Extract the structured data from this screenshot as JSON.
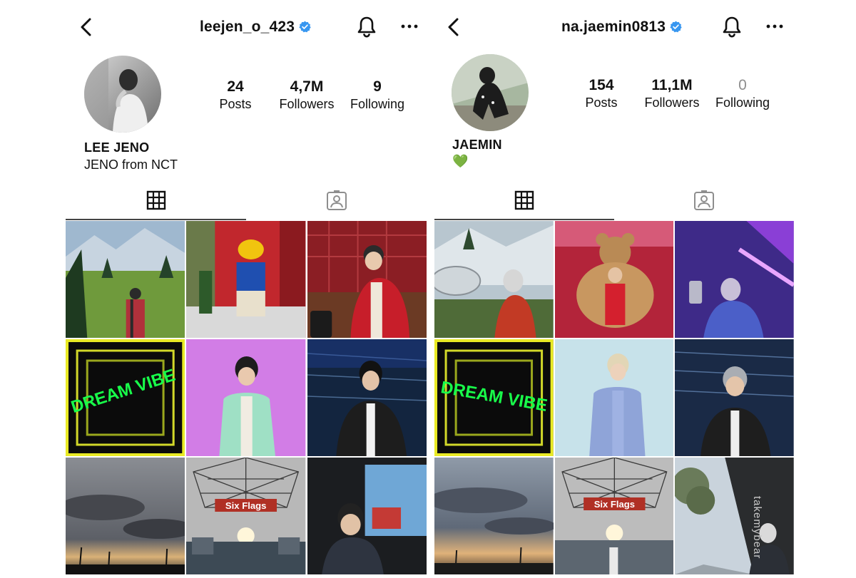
{
  "profiles": [
    {
      "username": "leejen_o_423",
      "display_name": "LEE JENO",
      "bio": "JENO from NCT",
      "posts_count": "24",
      "posts_label": "Posts",
      "followers_count": "4,7M",
      "followers_label": "Followers",
      "following_count": "9",
      "following_label": "Following"
    },
    {
      "username": "na.jaemin0813",
      "display_name": "JAEMIN",
      "bio": "💚",
      "posts_count": "154",
      "posts_label": "Posts",
      "followers_count": "11,1M",
      "followers_label": "Followers",
      "following_count": "0",
      "following_label": "Following"
    }
  ],
  "grid_signs": {
    "neon_1": "DREAM VIBE",
    "neon_2": "DREAM VIBE",
    "park_sign_1": "Six Flags",
    "park_sign_2": "Six Flags"
  },
  "watermark": "takemybear",
  "colors": {
    "verified": "#3897f0",
    "neon": "#18ff4a",
    "tab_underline": "#444444"
  }
}
